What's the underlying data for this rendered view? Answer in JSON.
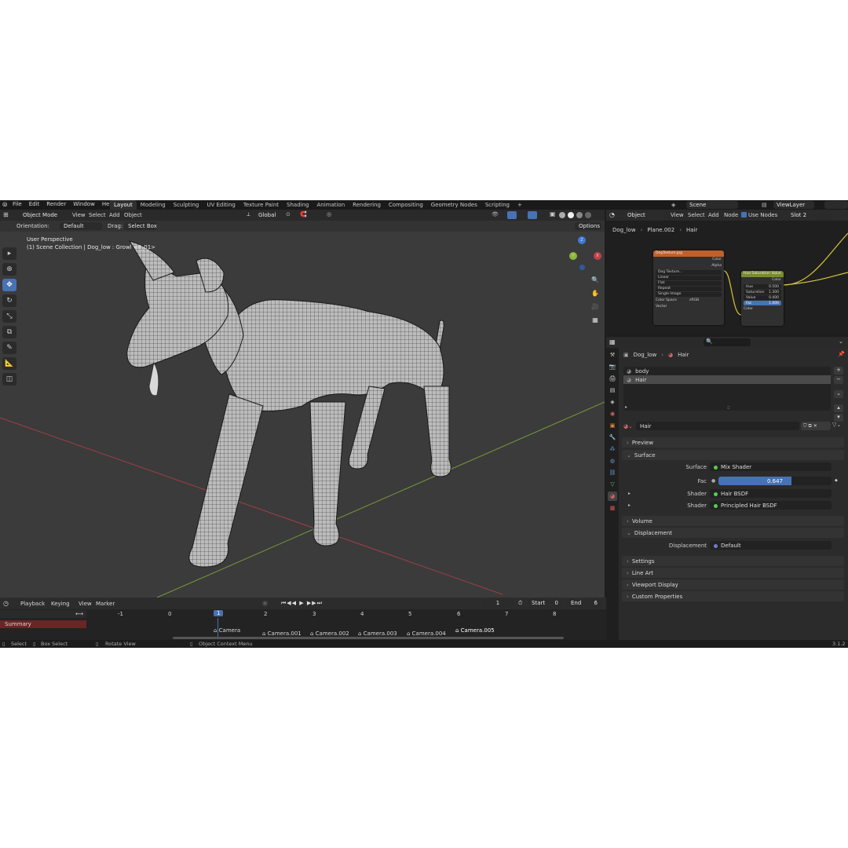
{
  "top_menu": [
    "File",
    "Edit",
    "Render",
    "Window",
    "Help"
  ],
  "workspaces": [
    "Layout",
    "Modeling",
    "Sculpting",
    "UV Editing",
    "Texture Paint",
    "Shading",
    "Animation",
    "Rendering",
    "Compositing",
    "Geometry Nodes",
    "Scripting"
  ],
  "active_workspace": "Layout",
  "scene_name": "Scene",
  "view_layer": "ViewLayer",
  "viewport": {
    "mode": "Object Mode",
    "menus": [
      "View",
      "Select",
      "Add",
      "Object"
    ],
    "transform_orientation": "Global",
    "orientation_label": "Orientation:",
    "orientation_value": "Default",
    "drag_label": "Drag:",
    "drag_value": "Select Box",
    "options_label": "Options",
    "overlay_line1": "User Perspective",
    "overlay_line2": "(1) Scene Collection | Dog_low : Growl <F_01>",
    "gizmo": {
      "x": "X",
      "y": "Y",
      "z": "Z"
    }
  },
  "timeline": {
    "menus": [
      "Playback",
      "Keying",
      "View",
      "Marker"
    ],
    "current_frame": "1",
    "start_label": "Start",
    "start": "0",
    "end_label": "End",
    "end": "6",
    "summary": "Summary",
    "ticks": [
      "-1",
      "0",
      "1",
      "2",
      "3",
      "4",
      "5",
      "6",
      "7",
      "8"
    ],
    "cameras": [
      "Camera",
      "Camera.001",
      "Camera.002",
      "Camera.003",
      "Camera.004",
      "Camera.005"
    ]
  },
  "status_bar": {
    "select": "Select",
    "box_select": "Box Select",
    "rotate_view": "Rotate View",
    "context_menu": "Object Context Menu",
    "version": "3.1.2"
  },
  "node_editor": {
    "object_label": "Object",
    "menus": [
      "View",
      "Select",
      "Add",
      "Node"
    ],
    "use_nodes": "Use Nodes",
    "slot": "Slot 2",
    "breadcrumb": [
      "Dog_low",
      "Plane.002",
      "Hair"
    ],
    "image_node": {
      "title": "DogTexture.jpg",
      "outputs": [
        "Color",
        "Alpha"
      ],
      "file": "Dog Texture...",
      "options": [
        "Linear",
        "Flat",
        "Repeat",
        "Single Image"
      ],
      "color_space_label": "Color Space",
      "color_space": "sRGB",
      "input": "Vector"
    },
    "hsv_node": {
      "title": "Hue Saturation Value",
      "output": "Color",
      "fields": [
        {
          "label": "Hue",
          "value": "0.500"
        },
        {
          "label": "Saturation",
          "value": "1.300"
        },
        {
          "label": "Value",
          "value": "0.400"
        },
        {
          "label": "Fac",
          "value": "1.000"
        }
      ],
      "input": "Color"
    }
  },
  "properties": {
    "breadcrumb": [
      "Dog_low",
      "Hair"
    ],
    "slots": [
      "body",
      "Hair"
    ],
    "material_name": "Hair",
    "sections": {
      "preview": "Preview",
      "surface": "Surface",
      "volume": "Volume",
      "displacement": "Displacement",
      "settings": "Settings",
      "line_art": "Line Art",
      "viewport_display": "Viewport Display",
      "custom_properties": "Custom Properties"
    },
    "surface_label": "Surface",
    "surface_value": "Mix Shader",
    "fac_label": "Fac",
    "fac_value": "0.647",
    "fac_fraction": 0.647,
    "shader1_label": "Shader",
    "shader1_value": "Hair BSDF",
    "shader2_label": "Shader",
    "shader2_value": "Principled Hair BSDF",
    "displacement_label": "Displacement",
    "displacement_value": "Default"
  },
  "colors": {
    "accent": "#4772b3",
    "x_axis": "#c2404a",
    "y_axis": "#8cb73a",
    "z_axis": "#3b7ad8",
    "image_node_header": "#c0602c",
    "hsv_node_header": "#7a8a33",
    "node_wire": "#d6c63a",
    "summary_row": "#6b2525"
  }
}
